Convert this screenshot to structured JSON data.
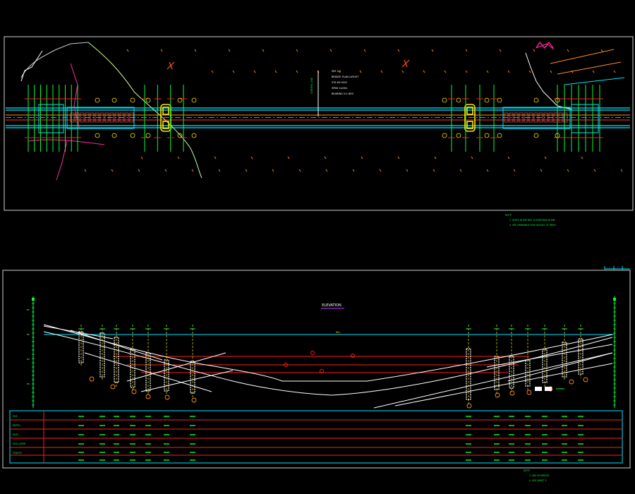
{
  "colors": {
    "background": "#000000",
    "frame": "#cfcfcf",
    "cyan": "#00e5ff",
    "green": "#00ff3c",
    "red": "#ff1e1e",
    "orange": "#ff8c1a",
    "yellow": "#ffe600",
    "magenta": "#ff2aa0",
    "white": "#ffffff"
  },
  "plan_view": {
    "center_notes": [
      "SEE 1.1",
      "BRIDGE PLAN LAYOUT",
      "STA K0+000",
      "SPAN 1x40m",
      "BEARING 0.0 DEG"
    ],
    "side_note": "CENTRE LINE",
    "legend_notes": [
      "NOTE",
      "1. UNITS IN METRES, ELEVATIONS IN MM",
      "2. SEE DRAWINGS FOR DETAILS OF PIERS"
    ]
  },
  "profile_view": {
    "title": "ELEVATION",
    "water_label": "W.L.",
    "elevation_labels": [
      "E1",
      "E2",
      "E3",
      "E4"
    ],
    "sheet_marks": [
      "1",
      "2"
    ],
    "table_rows": [
      "PILE",
      "DEPTH",
      "ELEV",
      "SOIL LAYER",
      "LENGTH"
    ],
    "footer_notes": [
      "NOTE",
      "1. SEE SCHEDULE",
      "2. SEE SHEET 2"
    ]
  }
}
